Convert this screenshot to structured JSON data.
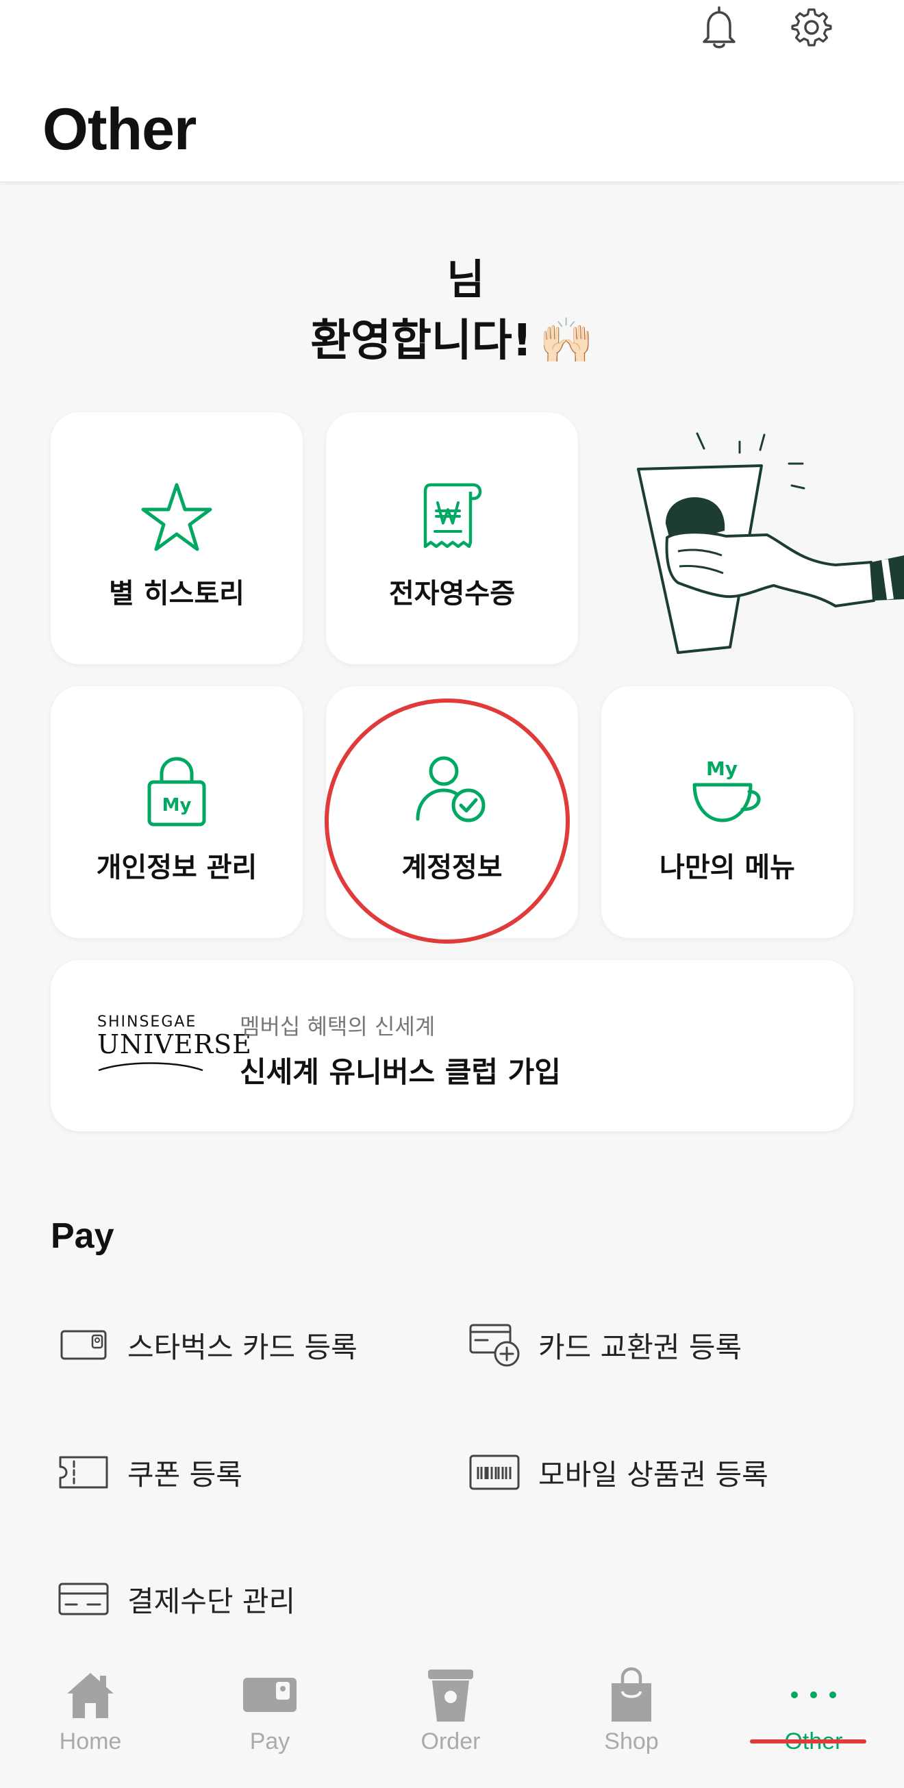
{
  "header": {
    "title": "Other",
    "bell_icon": "bell-icon",
    "settings_icon": "gear-icon"
  },
  "welcome": {
    "name_text": "님",
    "message": "환영합니다!",
    "emoji": "🙌🏻"
  },
  "tiles": {
    "star_history": "별 히스토리",
    "e_receipt": "전자영수증",
    "privacy": "개인정보 관리",
    "privacy_badge": "My",
    "account": "계정정보",
    "my_menu": "나만의 메뉴",
    "my_menu_badge": "My"
  },
  "club": {
    "logo_top": "SHINSEGAE",
    "logo_main": "UNIVERSE",
    "subtitle": "멤버십 혜택의 신세계",
    "title": "신세계 유니버스 클럽 가입"
  },
  "pay": {
    "section_title": "Pay",
    "items": [
      {
        "label": "스타벅스 카드 등록",
        "icon": "card-icon"
      },
      {
        "label": "카드 교환권 등록",
        "icon": "card-add-icon"
      },
      {
        "label": "쿠폰 등록",
        "icon": "coupon-icon"
      },
      {
        "label": "모바일 상품권 등록",
        "icon": "barcode-icon"
      },
      {
        "label": "결제수단 관리",
        "icon": "credit-card-icon"
      }
    ]
  },
  "nav": {
    "items": [
      {
        "label": "Home",
        "icon": "home-icon"
      },
      {
        "label": "Pay",
        "icon": "pay-icon"
      },
      {
        "label": "Order",
        "icon": "cup-icon"
      },
      {
        "label": "Shop",
        "icon": "bag-icon"
      },
      {
        "label": "Other",
        "icon": "more-icon",
        "active": true
      }
    ]
  },
  "colors": {
    "accent_green": "#00a862",
    "highlight_red": "#e03a3a",
    "background": "#f7f7f7"
  }
}
